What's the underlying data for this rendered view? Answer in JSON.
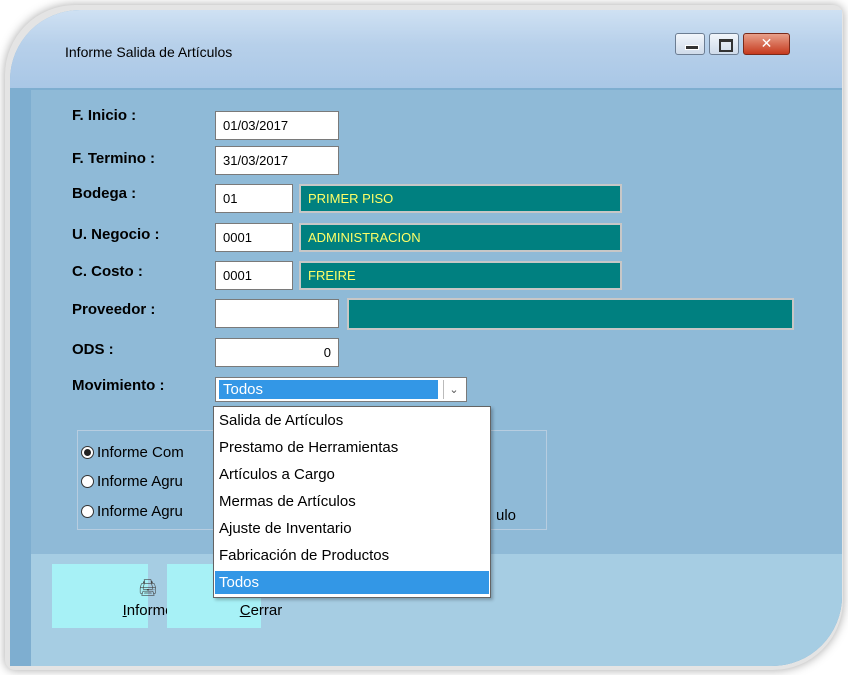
{
  "window": {
    "title": "Informe Salida de Artículos",
    "close_glyph": "✕"
  },
  "fields": {
    "inicio": {
      "label": "F. Inicio :",
      "value": "01/03/2017"
    },
    "termino": {
      "label": "F. Termino :",
      "value": "31/03/2017"
    },
    "bodega": {
      "label": "Bodega :",
      "code": "01",
      "name": "PRIMER PISO"
    },
    "negocio": {
      "label": "U. Negocio :",
      "code": "0001",
      "name": "ADMINISTRACION"
    },
    "costo": {
      "label": "C. Costo :",
      "code": "0001",
      "name": "FREIRE"
    },
    "proveedor": {
      "label": "Proveedor :",
      "code": "",
      "name": ""
    },
    "ods": {
      "label": "ODS :",
      "value": "0"
    },
    "movimiento": {
      "label": "Movimiento :",
      "selected": "Todos"
    }
  },
  "dropdown": {
    "options": [
      "Salida de Artículos",
      "Prestamo de Herramientas",
      "Artículos a Cargo",
      "Mermas de Artículos",
      "Ajuste de Inventario",
      "Fabricación de Productos",
      "Todos"
    ]
  },
  "radios": {
    "r1": "Informe Com",
    "r2": "Informe Agru",
    "r3": "Informe Agru",
    "r3_tail": "ulo"
  },
  "buttons": {
    "informe": {
      "label": "Informe",
      "icon": "printer-icon"
    },
    "cerrar": {
      "label": "Cerrar",
      "icon": "door-icon"
    }
  },
  "colors": {
    "teal_field": "#008080",
    "teal_text": "#ffff66",
    "selection": "#3397e6",
    "button_bg": "#a7f1f6"
  }
}
